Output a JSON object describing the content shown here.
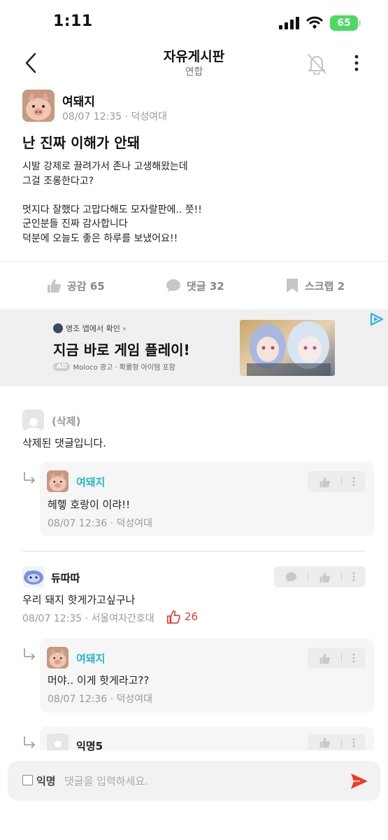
{
  "status_bar": {
    "time": "1:11",
    "battery": "65"
  },
  "header": {
    "title": "자유게시판",
    "subtitle": "연합"
  },
  "post": {
    "author": "여돼지",
    "meta": "08/07 12:35 · 덕성여대",
    "title": "난 진짜 이해가 안돼",
    "body": "시발 강제로 끌려가서 존나 고생해왔는데\n그걸 조롱한다고?\n\n멋지다 잘했다 고맙다해도 모자랄판에.. 쯧!!\n군인분들 진짜 감사합니다\n덕분에 오늘도 좋은 하루를 보냈어요!!"
  },
  "actions": {
    "like": "공감 65",
    "comment": "댓글 32",
    "scrap": "스크랩 2"
  },
  "ad": {
    "source": "명조 앱에서 확인 ›",
    "headline": "지금 바로 게임 플레이!",
    "badge": "AD",
    "footer": "Moloco 광고 · 확률형 아이템 포함"
  },
  "comments": [
    {
      "author": "(삭제)",
      "text": "삭제된 댓글입니다."
    },
    {
      "author": "듀따따",
      "text": "우리 돼지 핫게가고싶구나",
      "meta": "08/07 12:35 · 서울여자간호대",
      "likes": "26"
    }
  ],
  "replies": [
    {
      "author": "여돼지",
      "text": "헤헿 호랑이 이랴!!",
      "meta": "08/07 12:36 · 덕성여대"
    },
    {
      "author": "여돼지",
      "text": "머야.. 이게 핫게라고??",
      "meta": "08/07 12:36 · 덕성여대"
    },
    {
      "author": "익명5"
    }
  ],
  "input": {
    "anon_label": "익명",
    "placeholder": "댓글을 입력하세요."
  },
  "colors": {
    "accent_teal": "#24b6c8",
    "like_red": "#e63a2e",
    "send_red": "#f03a2a",
    "battery_green": "#4cd964"
  }
}
